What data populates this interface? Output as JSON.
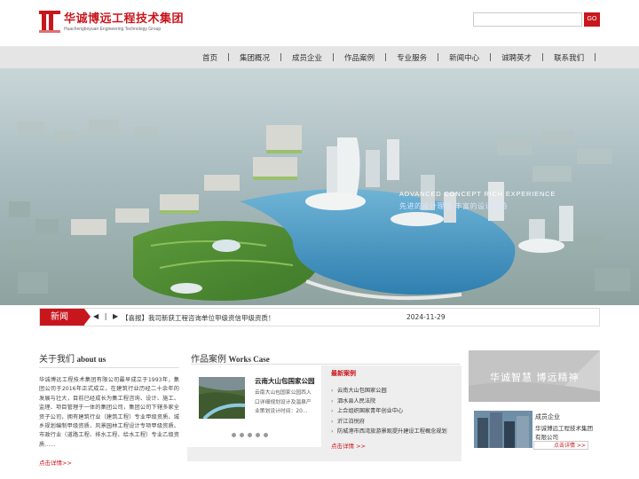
{
  "brand": {
    "name_cn": "华诚博远工程技术集团",
    "name_en": "Huachengboyuan Engineering Technology Group",
    "accent": "#c8161d"
  },
  "search": {
    "placeholder": "",
    "button": "GO"
  },
  "nav": {
    "items": [
      "首页",
      "集团概况",
      "成员企业",
      "作品案例",
      "专业服务",
      "新闻中心",
      "诚聘英才",
      "联系我们"
    ]
  },
  "banner": {
    "slogan_en": "ADVANCED  CONCEPT  RICH  EXPERIENCE",
    "slogan_cn": "先进的设计理念  丰富的设计经验"
  },
  "ticker": {
    "label": "新闻",
    "prev": "◀",
    "sep": "|",
    "next": "▶",
    "text": "【喜报】我司新获工程咨询单位甲级资信甲级资质！",
    "date": "2024-11-29"
  },
  "about": {
    "title_cn": "关于我们",
    "title_en": "about us",
    "body": "华诚博远工程技术集团有限公司最早成立于1993年，集团公司于2016年正式成立，在建筑行业历经二十余年的发展与壮大，目前已经成长为集工程咨询、设计、施工、监理、项目管理于一体的集团公司，集团公司下辖多家全资子公司，拥有建筑行业（建筑工程）专业甲级资质、城乡规划编制甲级资质、风景园林工程设计专项甲级资质、市政行业（道路工程、排水工程、给水工程）专业乙级资质……",
    "more": "点击详情>>"
  },
  "works": {
    "title_cn": "作品案例",
    "title_en": "Works Case",
    "card_title": "云南大山包国家公园",
    "card_desc": "云南大山包国家公园西入口详细规划设计及温泉产业策划设计时间：20...",
    "latest_title": "最新案例",
    "latest": [
      "云南大山包国家公园",
      "泗水县人民法院",
      "上合组织国家青年创业中心",
      "沂江泊悦府",
      "防城港市西湾旅游景观提升建设工程概念规划"
    ],
    "more": "点击详情 >>",
    "dots": 5
  },
  "side": {
    "spirit": "华诚智慧  博远精神",
    "ent_title": "成员企业",
    "ent_desc": "华诚博远工程技术集团有限公司",
    "ent_more": "点击详情 >>"
  }
}
